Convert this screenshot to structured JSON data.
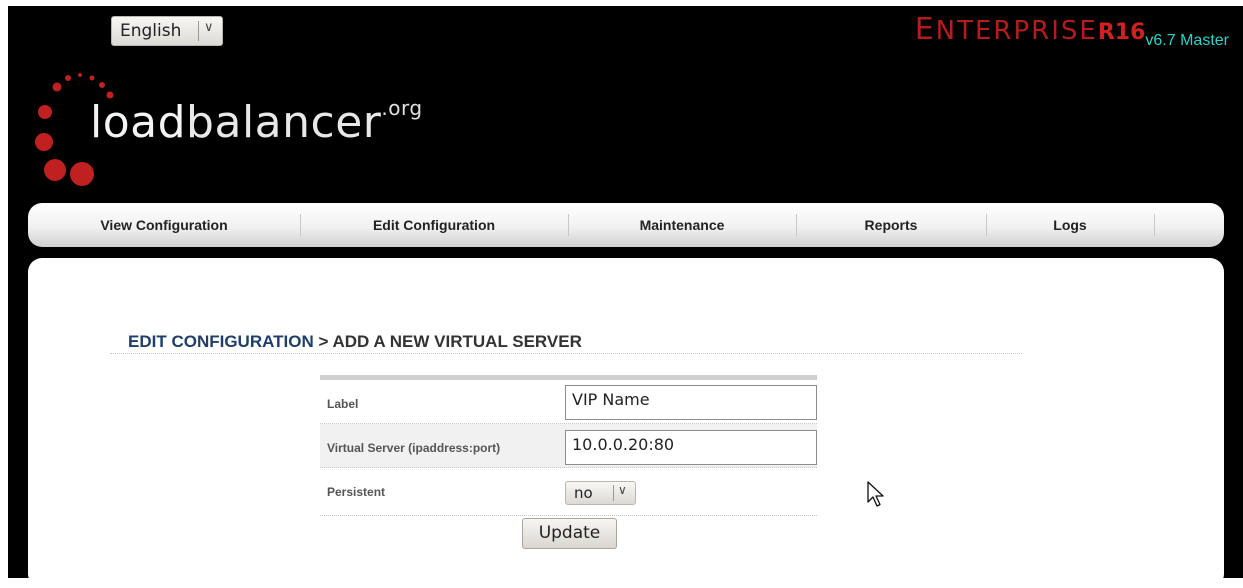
{
  "language": {
    "selected": "English"
  },
  "brand": {
    "enterprise_first": "E",
    "enterprise_rest": "NTERPRISE",
    "edition": "R16",
    "version": "v6.7 Master"
  },
  "logo": {
    "main_bold": "load",
    "main_rest": "balancer",
    "suffix": ".org"
  },
  "nav": {
    "items": [
      {
        "label": "View Configuration"
      },
      {
        "label": "Edit Configuration"
      },
      {
        "label": "Maintenance"
      },
      {
        "label": "Reports"
      },
      {
        "label": "Logs"
      }
    ]
  },
  "page": {
    "breadcrumb": "EDIT CONFIGURATION",
    "separator": " > ",
    "title": "ADD A NEW VIRTUAL SERVER"
  },
  "form": {
    "label_field": {
      "label": "Label",
      "value": "VIP Name"
    },
    "virtual_server_field": {
      "label": "Virtual Server (ipaddress:port)",
      "value": "10.0.0.20:80"
    },
    "persistent_field": {
      "label": "Persistent",
      "value": "no"
    },
    "update_label": "Update"
  },
  "colors": {
    "background": "#000000",
    "brand_red": "#b51c1c",
    "version_teal": "#2ad4c8",
    "heading_blue": "#1f3f6a",
    "logo_red": "#c0201f"
  }
}
